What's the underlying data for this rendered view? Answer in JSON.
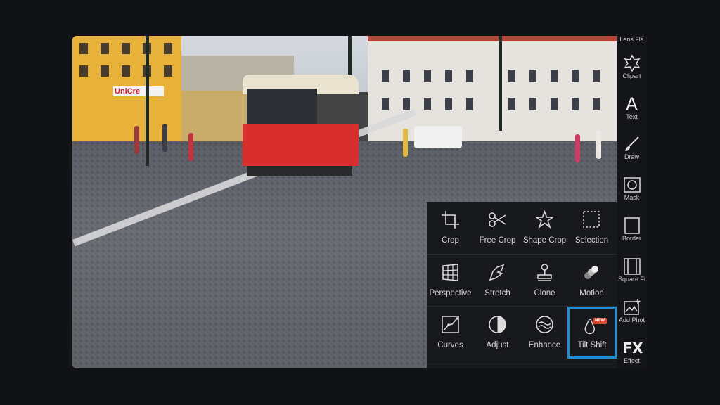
{
  "photo": {
    "sign_text": "UniCre"
  },
  "toolbar": {
    "top_label": "Lens Fla",
    "items": [
      {
        "label": "Clipart",
        "icon": "clipart-icon"
      },
      {
        "label": "Text",
        "icon": "text-icon"
      },
      {
        "label": "Draw",
        "icon": "brush-icon"
      },
      {
        "label": "Mask",
        "icon": "mask-icon"
      },
      {
        "label": "Border",
        "icon": "border-icon"
      },
      {
        "label": "Square Fi",
        "icon": "square-fit-icon"
      },
      {
        "label": "Add Phot",
        "icon": "add-photo-icon"
      },
      {
        "label": "Effect",
        "icon": "fx-icon"
      }
    ],
    "text_glyph": "A",
    "fx_glyph": "FX"
  },
  "tools": {
    "rows": [
      [
        {
          "label": "Crop",
          "icon": "crop-icon"
        },
        {
          "label": "Free Crop",
          "icon": "scissors-icon"
        },
        {
          "label": "Shape Crop",
          "icon": "star-icon"
        },
        {
          "label": "Selection",
          "icon": "selection-icon"
        }
      ],
      [
        {
          "label": "Perspective",
          "icon": "perspective-icon"
        },
        {
          "label": "Stretch",
          "icon": "stretch-icon"
        },
        {
          "label": "Clone",
          "icon": "stamp-icon"
        },
        {
          "label": "Motion",
          "icon": "motion-icon"
        }
      ],
      [
        {
          "label": "Curves",
          "icon": "curves-icon"
        },
        {
          "label": "Adjust",
          "icon": "adjust-icon"
        },
        {
          "label": "Enhance",
          "icon": "enhance-icon"
        },
        {
          "label": "Tilt Shift",
          "icon": "tilt-shift-icon",
          "badge": "NEW",
          "selected": true
        }
      ]
    ]
  },
  "colors": {
    "accent": "#1e8fd6",
    "badge": "#e0472f",
    "background": "#111216"
  }
}
